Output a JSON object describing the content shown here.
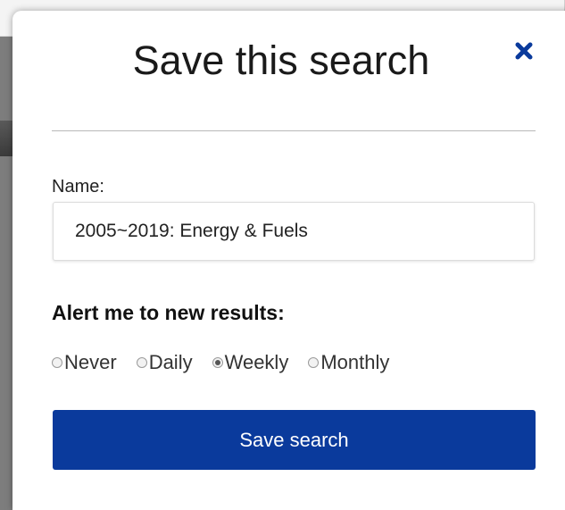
{
  "modal": {
    "title": "Save this search",
    "close_icon": "close-icon",
    "name_label": "Name:",
    "name_value": "2005~2019: Energy & Fuels",
    "alert_label": "Alert me to new results:",
    "alert_options": [
      {
        "label": "Never",
        "checked": false
      },
      {
        "label": "Daily",
        "checked": false
      },
      {
        "label": "Weekly",
        "checked": true
      },
      {
        "label": "Monthly",
        "checked": false
      }
    ],
    "save_button_label": "Save search"
  },
  "colors": {
    "accent": "#0a3a9c",
    "close_icon": "#0a3a9c"
  }
}
